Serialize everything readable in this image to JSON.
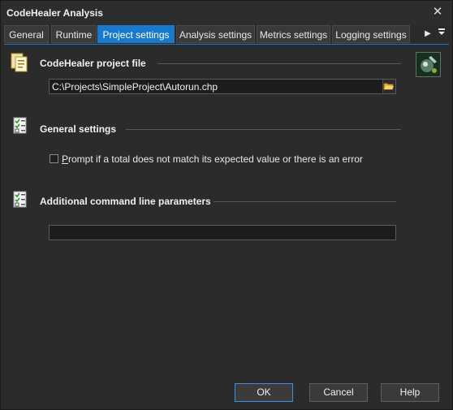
{
  "window": {
    "title": "CodeHealer Analysis"
  },
  "tabs": [
    {
      "label": "General"
    },
    {
      "label": "Runtime"
    },
    {
      "label": "Project settings",
      "active": true
    },
    {
      "label": "Analysis settings"
    },
    {
      "label": "Metrics settings"
    },
    {
      "label": "Logging settings"
    }
  ],
  "sections": {
    "project_file": {
      "title": "CodeHealer project file",
      "path_value": "C:\\Projects\\SimpleProject\\Autorun.chp"
    },
    "general": {
      "title": "General settings",
      "prompt_label": "Prompt if a total does not match its expected value or there is an error",
      "prompt_access_key": "P",
      "prompt_label_rest": "rompt if a total does not match its expected value or there is an error",
      "prompt_checked": false
    },
    "additional": {
      "title": "Additional command line parameters",
      "params_value": ""
    }
  },
  "buttons": {
    "ok": "OK",
    "cancel": "Cancel",
    "help": "Help"
  },
  "colors": {
    "accent": "#1979ca",
    "background": "#2b2b2b"
  },
  "icons": {
    "close": "close-icon",
    "scroll_right": "chevron-right-icon",
    "tab_menu": "tab-list-icon",
    "project_file": "project-file-icon",
    "checklist": "checklist-icon",
    "browse": "folder-open-icon",
    "logo": "codehealer-logo-icon"
  }
}
